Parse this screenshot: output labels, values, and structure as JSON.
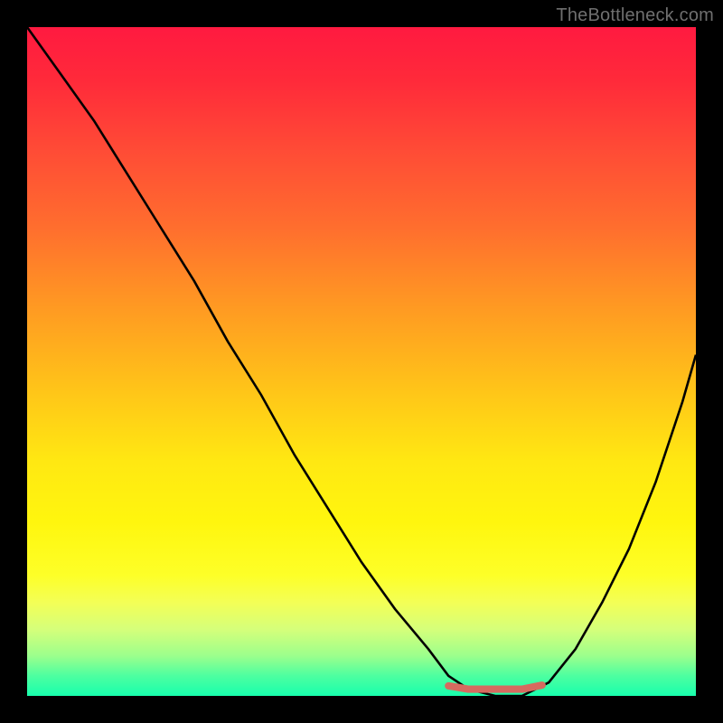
{
  "watermark": "TheBottleneck.com",
  "chart_data": {
    "type": "line",
    "title": "",
    "xlabel": "",
    "ylabel": "",
    "xlim": [
      0,
      100
    ],
    "ylim": [
      0,
      100
    ],
    "grid": false,
    "legend": false,
    "background_gradient": {
      "orientation": "vertical",
      "stops": [
        {
          "pos": 0.0,
          "color": "#ff1a40"
        },
        {
          "pos": 0.3,
          "color": "#ff6e2e"
        },
        {
          "pos": 0.55,
          "color": "#ffc718"
        },
        {
          "pos": 0.8,
          "color": "#fdff28"
        },
        {
          "pos": 1.0,
          "color": "#18ffad"
        }
      ]
    },
    "series": [
      {
        "name": "bottleneck-curve",
        "color": "#000000",
        "x": [
          0,
          5,
          10,
          15,
          20,
          25,
          30,
          35,
          40,
          45,
          50,
          55,
          60,
          63,
          66,
          70,
          74,
          78,
          82,
          86,
          90,
          94,
          98,
          100
        ],
        "y": [
          100,
          93,
          86,
          78,
          70,
          62,
          53,
          45,
          36,
          28,
          20,
          13,
          7,
          3,
          1,
          0,
          0,
          2,
          7,
          14,
          22,
          32,
          44,
          51
        ]
      },
      {
        "name": "optimal-band",
        "color": "#d66a5f",
        "x": [
          63,
          66,
          70,
          74,
          77
        ],
        "y": [
          1.5,
          1.0,
          1.0,
          1.0,
          1.6
        ]
      }
    ],
    "annotations": []
  }
}
